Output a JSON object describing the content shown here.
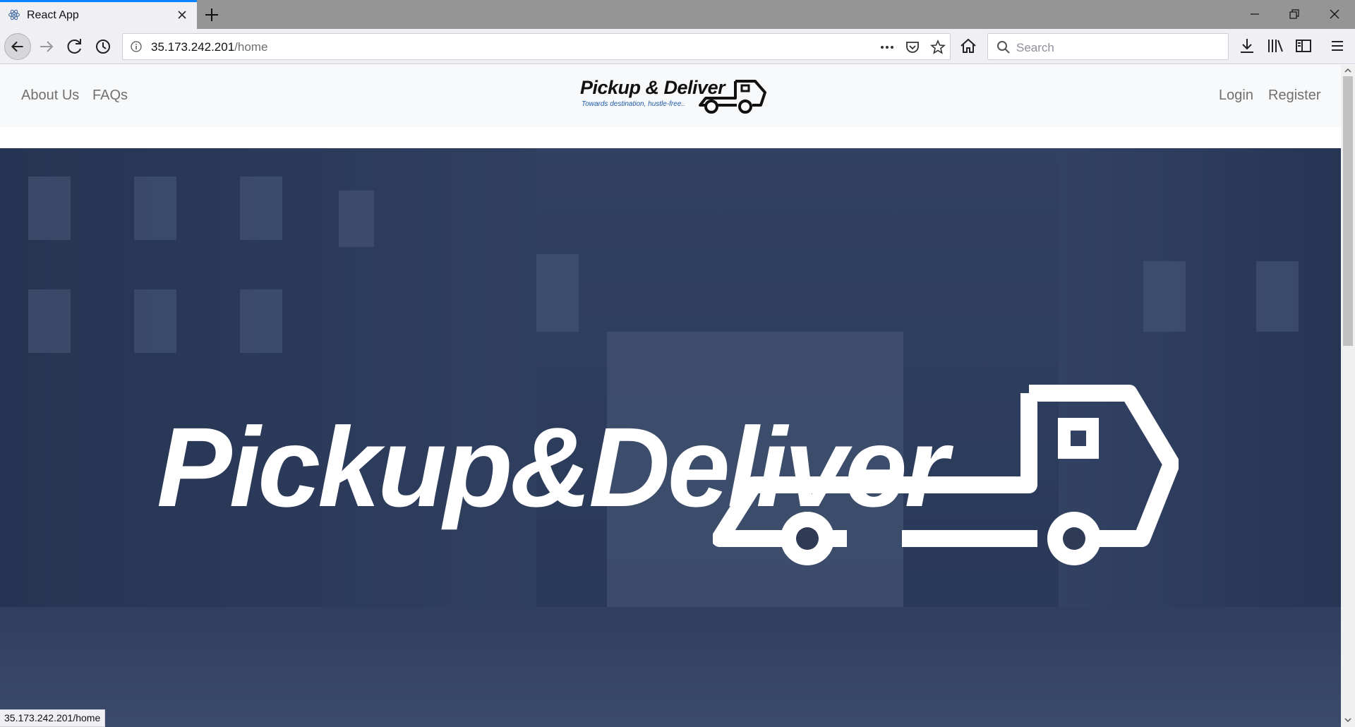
{
  "browser": {
    "tab_title": "React App",
    "url_host": "35.173.242.201",
    "url_path": "/home",
    "search_placeholder": "Search",
    "status_text": "35.173.242.201/home"
  },
  "site": {
    "nav_left": [
      "About Us",
      "FAQs"
    ],
    "nav_right": [
      "Login",
      "Register"
    ],
    "logo_text": "Pickup & Deliver",
    "logo_tagline": "Towards destination, hustle-free..",
    "hero_text": "Pickup&Deliver"
  },
  "colors": {
    "tab_accent": "#0a84ff",
    "hero_overlay": "#1e305a",
    "logo_tagline": "#1e5aa8"
  },
  "icons": [
    "react-favicon-icon",
    "close-icon",
    "plus-icon",
    "minimize-icon",
    "restore-icon",
    "close-window-icon",
    "back-arrow-icon",
    "forward-arrow-icon",
    "reload-icon",
    "history-icon",
    "info-icon",
    "more-icon",
    "pocket-icon",
    "star-icon",
    "home-icon",
    "search-icon",
    "download-icon",
    "library-icon",
    "sidebar-icon",
    "menu-icon",
    "truck-icon"
  ]
}
